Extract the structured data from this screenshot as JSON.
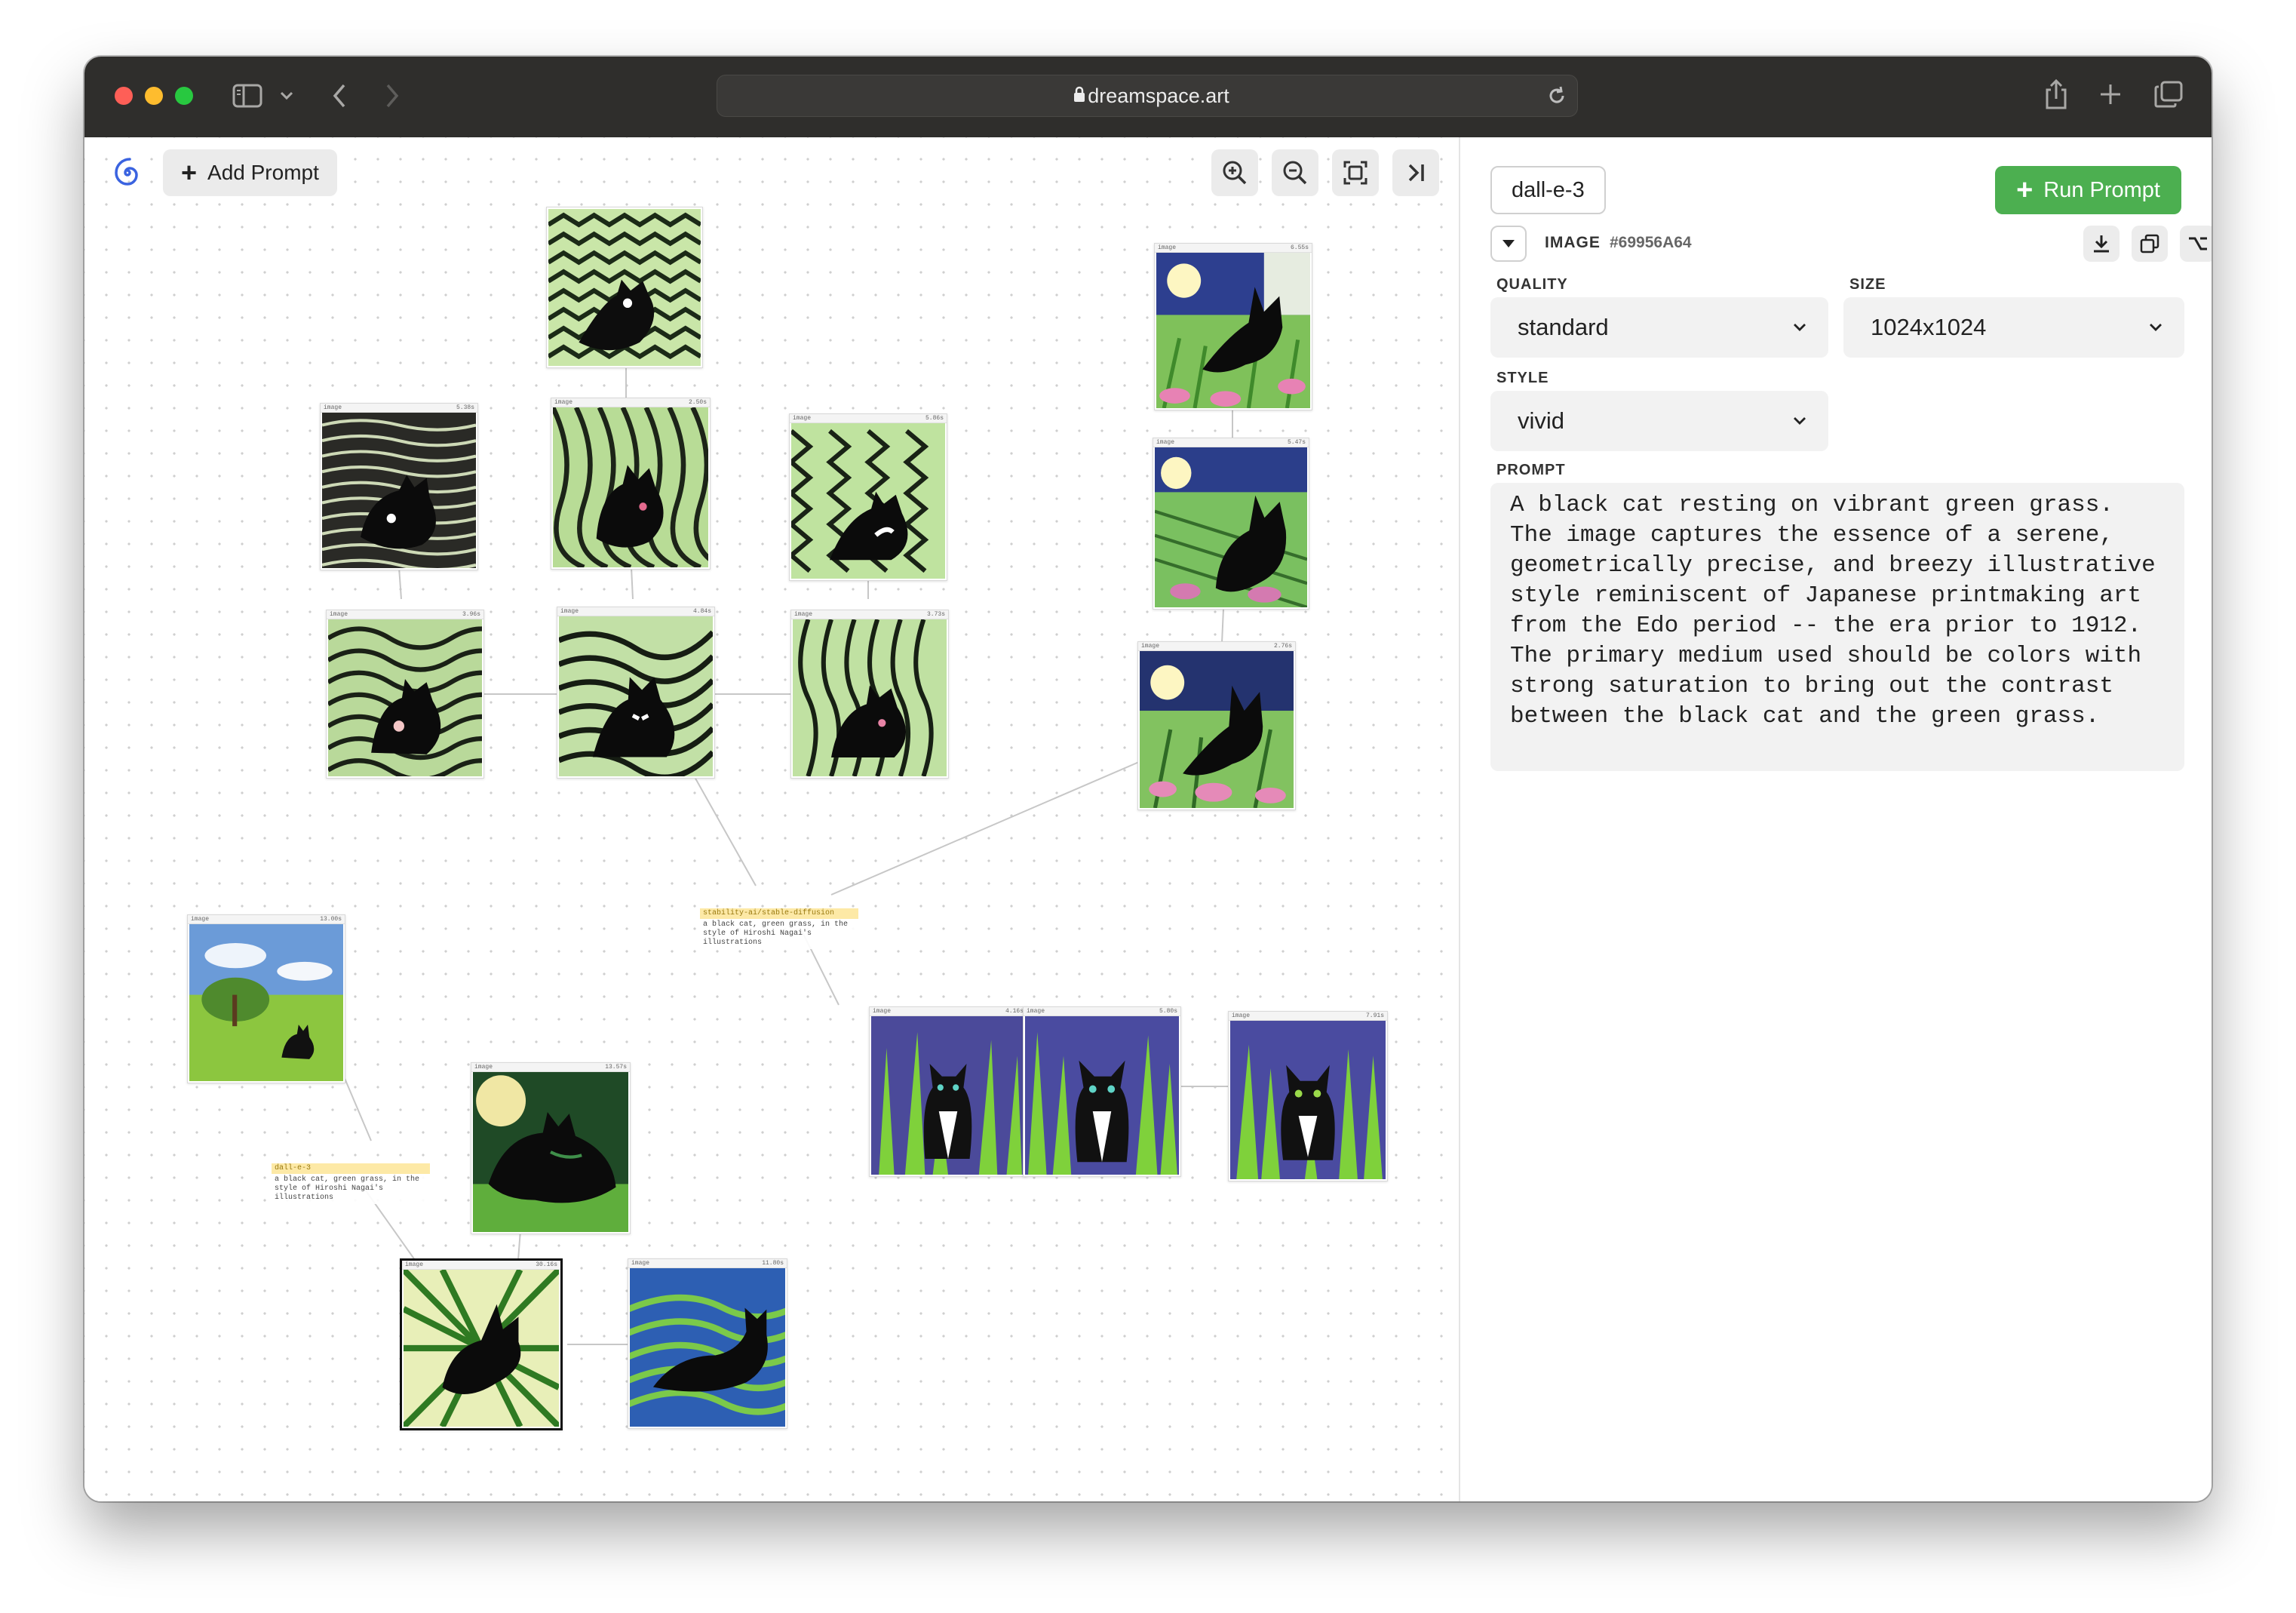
{
  "browser": {
    "url": "dreamspace.art"
  },
  "canvas_toolbar": {
    "add_prompt_label": "Add Prompt"
  },
  "nodes": {
    "image_label": "image",
    "times": [
      "5.38s",
      "2.50s",
      "5.86s",
      "3.96s",
      "4.84s",
      "3.73s",
      "6.55s",
      "5.47s",
      "2.76s",
      "13.00s",
      "4.16s",
      "5.80s",
      "7.91s",
      "13.57s",
      "30.16s",
      "11.80s"
    ]
  },
  "prompt_nodes": [
    {
      "model": "stability-ai/stable-diffusion",
      "text": "a black cat, green grass, in the style of Hiroshi Nagai's illustrations"
    },
    {
      "model": "dall-e-3",
      "text": "a black cat, green grass, in the style of Hiroshi Nagai's illustrations"
    }
  ],
  "panel": {
    "model": "dall-e-3",
    "run_label": "Run Prompt",
    "type": "IMAGE",
    "id": "#69956A64",
    "quality": {
      "label": "QUALITY",
      "value": "standard"
    },
    "size": {
      "label": "SIZE",
      "value": "1024x1024"
    },
    "style": {
      "label": "STYLE",
      "value": "vivid"
    },
    "prompt": {
      "label": "PROMPT",
      "value": "A black cat resting on vibrant green grass. The image captures the essence of a serene, geometrically precise, and breezy illustrative style reminiscent of Japanese printmaking art from the Edo period -- the era prior to 1912. The primary medium used should be colors with strong saturation to bring out the contrast between the black cat and the green grass."
    }
  },
  "colors": {
    "run_button": "#4caf50",
    "titlebar": "#2f2e2c"
  }
}
